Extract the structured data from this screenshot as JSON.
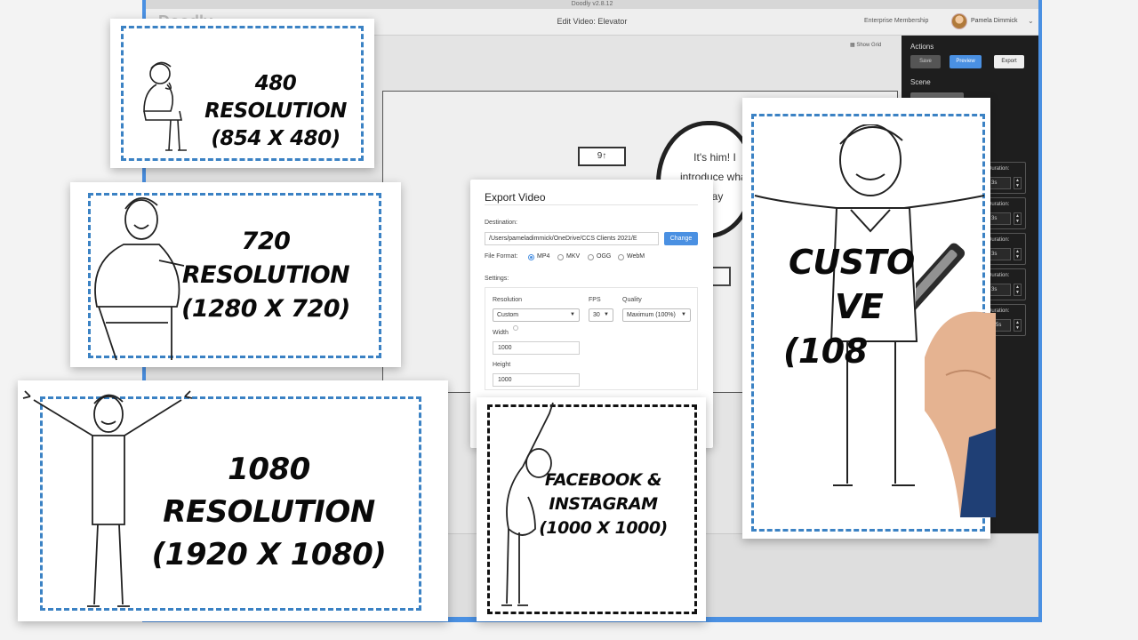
{
  "app": {
    "window_title": "Doodly v2.8.12",
    "logo": "Doodly",
    "page_title": "Edit Video: Elevator",
    "membership": "Enterprise Membership",
    "user_name": "Pamela Dimmick",
    "show_grid": "Show Grid",
    "bubble_text": "It's him! I introduce what say",
    "elevator_sign": "9↑"
  },
  "side_panel": {
    "actions_title": "Actions",
    "save": "Save",
    "preview": "Preview",
    "export": "Export",
    "scene_title": "Scene",
    "durations": [
      {
        "label": "Duration:",
        "value": "3s"
      },
      {
        "label": "Duration:",
        "value": "3s"
      },
      {
        "label": "Duration:",
        "value": "3s"
      },
      {
        "label": "Duration:",
        "value": "3s"
      },
      {
        "label": "Duration:",
        "value": "1.5s"
      }
    ]
  },
  "export_dialog": {
    "title": "Export Video",
    "destination_label": "Destination:",
    "destination_path": "/Users/pameladimmick/OneDrive/CCS Clients 2021/E",
    "change_button": "Change",
    "file_format_label": "File Format:",
    "formats": [
      "MP4",
      "MKV",
      "OGG",
      "WebM"
    ],
    "selected_format": "MP4",
    "settings_label": "Settings:",
    "resolution_label": "Resolution",
    "resolution_value": "Custom",
    "fps_label": "FPS",
    "fps_value": "30",
    "quality_label": "Quality",
    "quality_value": "Maximum (100%)",
    "width_label": "Width",
    "width_value": "1000",
    "height_label": "Height",
    "height_value": "1000"
  },
  "cards": {
    "res480": {
      "line1": "480 RESOLUTION",
      "line2": "(854 X 480)"
    },
    "res720": {
      "line1": "720 RESOLUTION",
      "line2": "(1280 X 720)"
    },
    "res1080": {
      "line1": "1080 RESOLUTION",
      "line2": "(1920 X 1080)"
    },
    "social": {
      "line1": "FACEBOOK &",
      "line2": "INSTAGRAM",
      "line3": "(1000 X 1000)"
    },
    "custom": {
      "line1": "CUSTO",
      "line2": "VE",
      "line3": "(108"
    }
  },
  "colors": {
    "accent": "#4a90e2",
    "dashed_border": "#3b82c4",
    "side_panel_bg": "#1e1e1e"
  }
}
